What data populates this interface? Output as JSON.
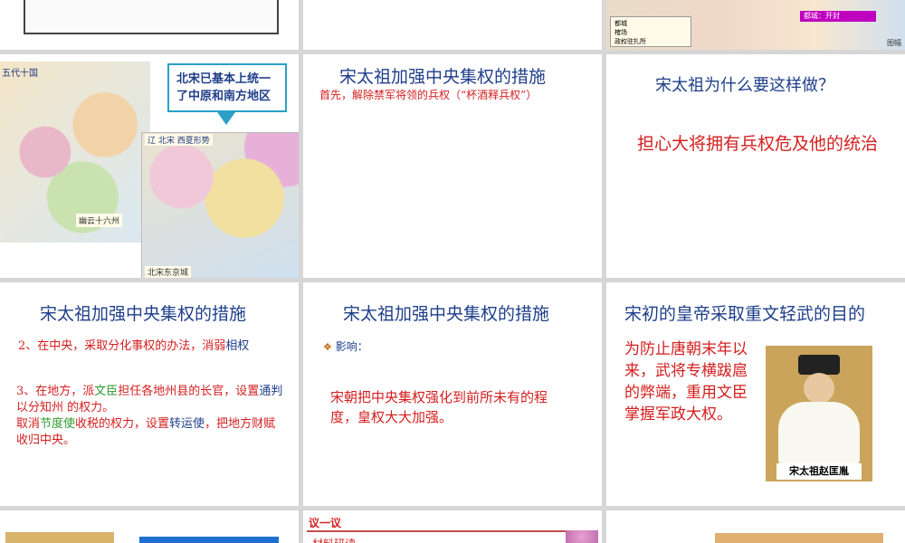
{
  "slides": {
    "s1": {},
    "s2": {},
    "s3": {
      "legend": [
        "都城",
        "榷场",
        "政权驻扎所"
      ],
      "capital_label": "都城：开封",
      "corner_label": "图幅"
    },
    "s4": {
      "map_left_title": "五代十国",
      "bubble_text_1": "北宋已基本上统一",
      "bubble_text_2": "了中原和南方地区",
      "map_right_title": "辽 北宋 西夏形势",
      "map_right_bottom": "北宋东京城",
      "map_left_bottom": "幽云十六州"
    },
    "s5": {
      "title": "宋太祖加强中央集权的措施",
      "subtitle": "首先，解除禁军将领的兵权（“杯酒释兵权”）"
    },
    "s6": {
      "title": "宋太祖为什么要这样做？",
      "answer": "担心大将拥有兵权危及他的统治"
    },
    "s7": {
      "title": "宋太祖加强中央集权的措施",
      "p1_num": "2",
      "p1_text": "、在中央，采取分化事权的办法，消弱",
      "p1_blue": "相权",
      "p2_a": "3、在地方，派",
      "p2_green": "文臣",
      "p2_b": "担任各地州县的长官，设置",
      "p2_blue": "通判",
      "p2_c": "以分知州 的权力。",
      "p3_a": "取消",
      "p3_green": "节度使",
      "p3_b": "收税的权力，设置",
      "p3_blue": "转运使",
      "p3_c": "，把地方财赋收归中央。"
    },
    "s8": {
      "title": "宋太祖加强中央集权的措施",
      "bullet": "影响：",
      "body": "宋朝把中央集权强化到前所未有的程度，皇权大大加强。"
    },
    "s9": {
      "title": "宋初的皇帝采取重文轻武的目的",
      "body": "为防止唐朝末年以来，武将专横跋扈的弊端，重用文臣掌握军政大权。",
      "caption": "宋太祖赵匡胤"
    },
    "s11": {
      "label": "议一议",
      "sub": "材料研读"
    }
  },
  "colors": {
    "title": "#1f3f8a",
    "red": "#d42020",
    "green": "#2e9a2e"
  }
}
